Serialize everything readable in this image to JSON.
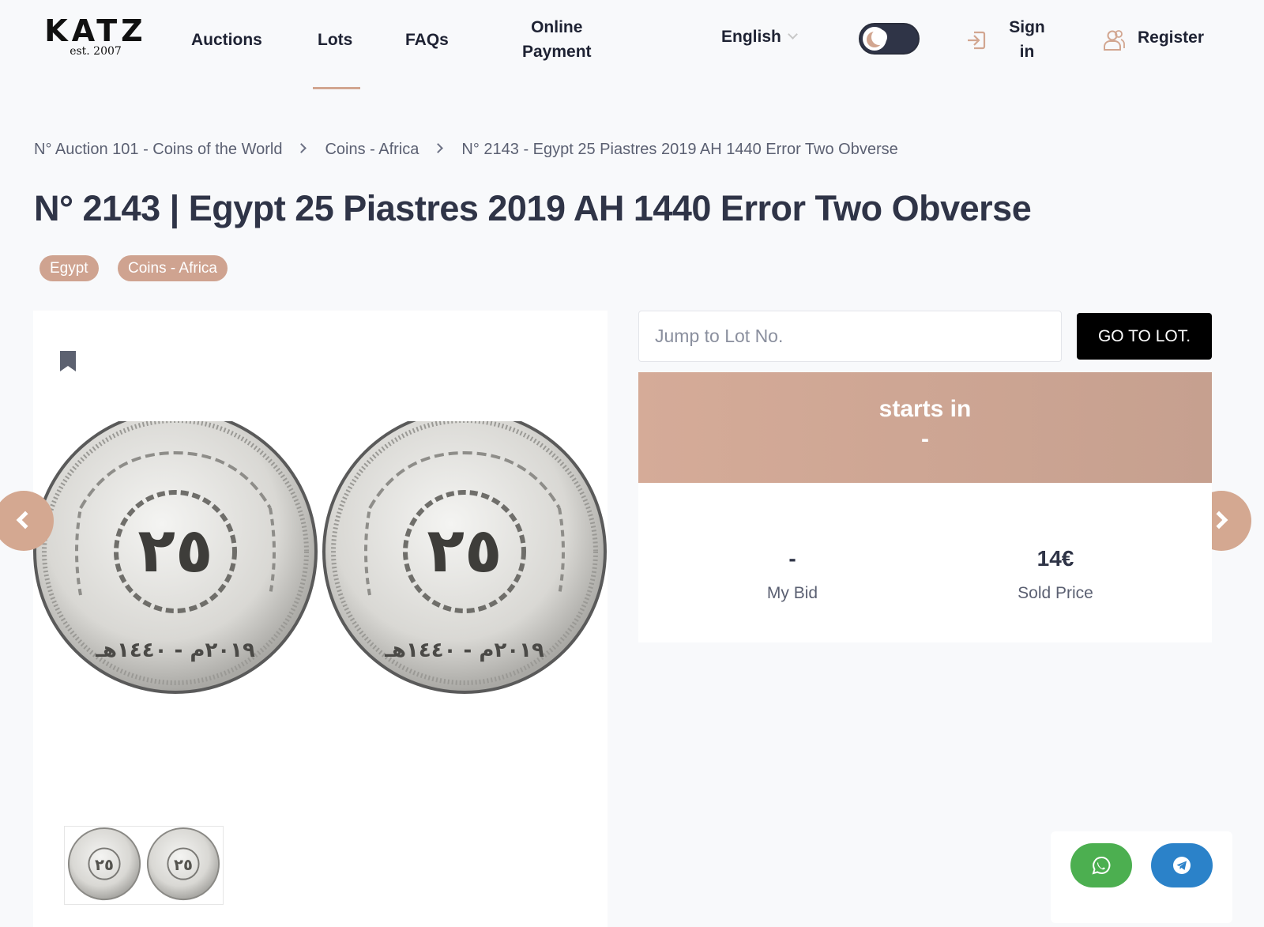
{
  "header": {
    "logo_text": "KATZ",
    "logo_est": "est. 2007",
    "nav": [
      {
        "label": "Auctions"
      },
      {
        "label": "Lots"
      },
      {
        "label": "FAQs"
      },
      {
        "label_line1": "Online",
        "label_line2": "Payment"
      }
    ],
    "language": "English",
    "sign_in_line1": "Sign",
    "sign_in_line2": "in",
    "register": "Register",
    "accent_color": "#d2a690"
  },
  "breadcrumb": [
    "N° Auction 101 - Coins of the World",
    "Coins - Africa",
    "N° 2143 - Egypt 25 Piastres 2019 AH 1440 Error Two Obverse"
  ],
  "lot": {
    "title": "N° 2143 | Egypt 25 Piastres 2019 AH 1440 Error Two Obverse",
    "tags": [
      "Egypt",
      "Coins - Africa"
    ],
    "coin_numeral": "٢٥",
    "coin_date": "٢٠١٩م - ١٤٤٠هـ"
  },
  "jump": {
    "placeholder": "Jump to Lot No.",
    "button": "GO TO LOT."
  },
  "timer": {
    "label": "starts in",
    "value": "-"
  },
  "stats": {
    "my_bid_value": "-",
    "my_bid_label": "My Bid",
    "sold_price_value": "14€",
    "sold_price_label": "Sold Price"
  },
  "share": {
    "whatsapp_color": "#4caf50",
    "telegram_color": "#2b82c9"
  }
}
